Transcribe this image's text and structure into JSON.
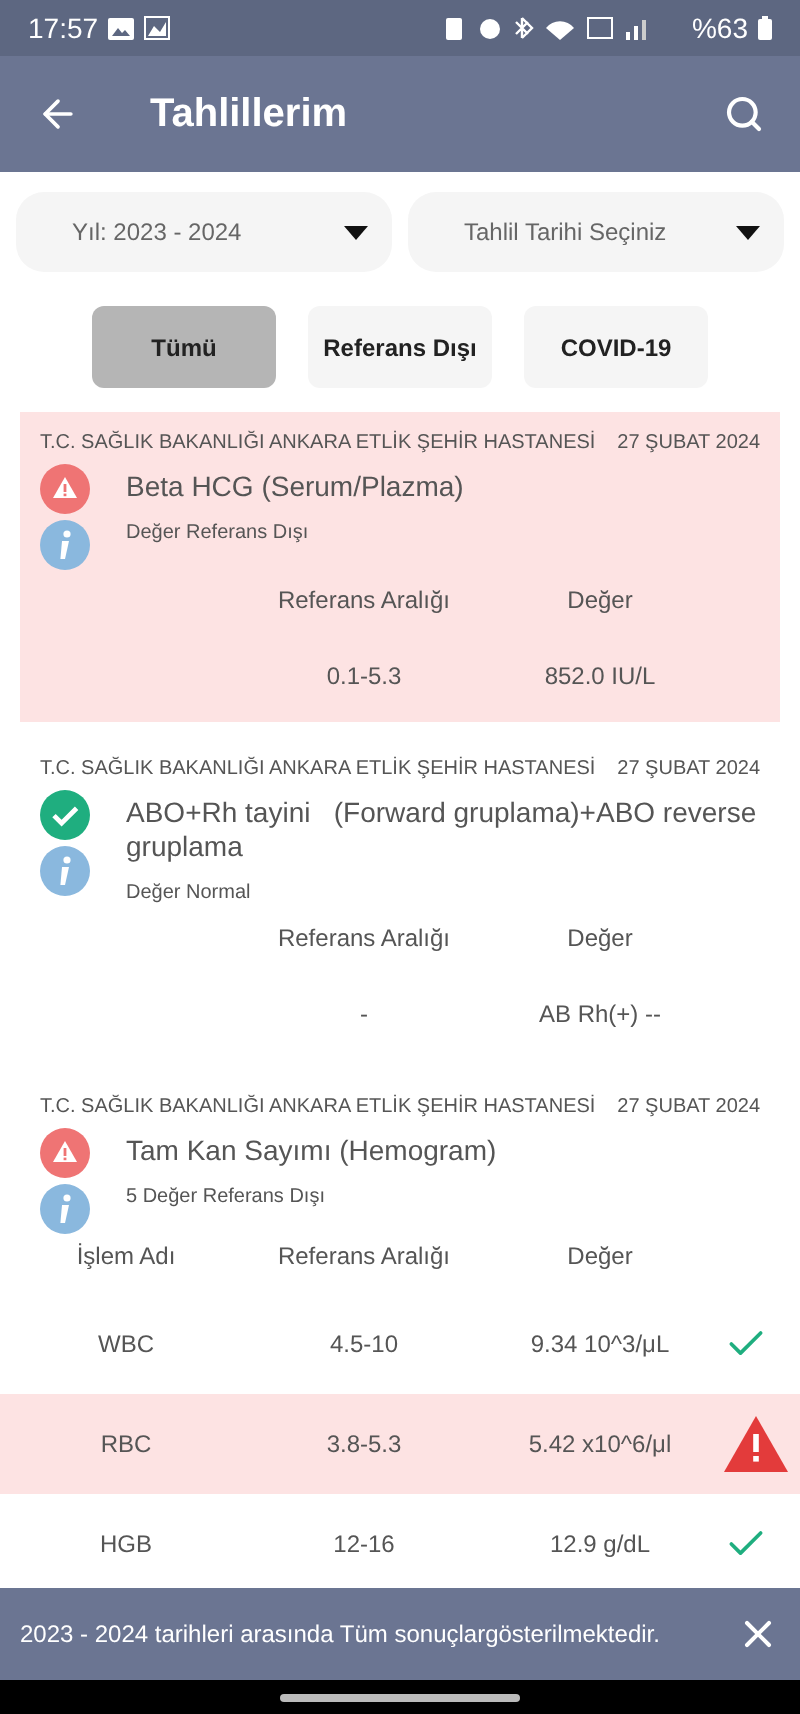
{
  "status_bar": {
    "time": "17:57",
    "battery": "%63"
  },
  "app_bar": {
    "title": "Tahlillerim"
  },
  "dropdowns": [
    {
      "value": "Yıl: 2023 - 2024"
    },
    {
      "value": "Tahlil Tarihi Seçiniz"
    }
  ],
  "filters": [
    {
      "label": "Tümü",
      "selected": true
    },
    {
      "label": "Referans Dışı",
      "selected": false
    },
    {
      "label": "COVID-19",
      "selected": false
    }
  ],
  "results": [
    {
      "hospital": "T.C. SAĞLIK BAKANLIĞI ANKARA ETLİK ŞEHİR HASTANESİ",
      "date": "27 ŞUBAT 2024",
      "name": "Beta HCG (Serum/Plazma)",
      "kind": "single",
      "out_of_range": true,
      "note": "Değer Referans Dışı",
      "headers": [
        "Referans Aralığı",
        "Değer"
      ],
      "rows": [
        {
          "cells": [
            "0.1-5.3",
            "852.0 IU/L"
          ]
        }
      ]
    },
    {
      "hospital": "T.C. SAĞLIK BAKANLIĞI ANKARA ETLİK ŞEHİR HASTANESİ",
      "date": "27 ŞUBAT 2024",
      "name": "ABO+Rh tayini   (Forward gruplama)+ABO reverse gruplama",
      "kind": "single",
      "out_of_range": false,
      "note": "Değer Normal",
      "headers": [
        "Referans Aralığı",
        "Değer"
      ],
      "rows": [
        {
          "cells": [
            "-",
            "AB Rh(+) --"
          ]
        }
      ]
    },
    {
      "hospital": "T.C. SAĞLIK BAKANLIĞI ANKARA ETLİK ŞEHİR HASTANESİ",
      "date": "27 ŞUBAT 2024",
      "name": "Tam Kan Sayımı (Hemogram)",
      "kind": "table",
      "out_of_range": true,
      "note": "5 Değer Referans Dışı",
      "headers": [
        "İşlem Adı",
        "Referans Aralığı",
        "Değer"
      ],
      "rows": [
        {
          "cells": [
            "WBC",
            "4.5-10",
            "9.34 10^3/μL"
          ],
          "out_of_range": false
        },
        {
          "cells": [
            "RBC",
            "3.8-5.3",
            "5.42 x10^6/μl"
          ],
          "out_of_range": true
        },
        {
          "cells": [
            "HGB",
            "12-16",
            "12.9 g/dL"
          ],
          "out_of_range": false
        }
      ]
    }
  ],
  "snackbar": {
    "message": "2023 - 2024 tarihleri arasında Tüm sonuçlargösterilmektedir."
  }
}
